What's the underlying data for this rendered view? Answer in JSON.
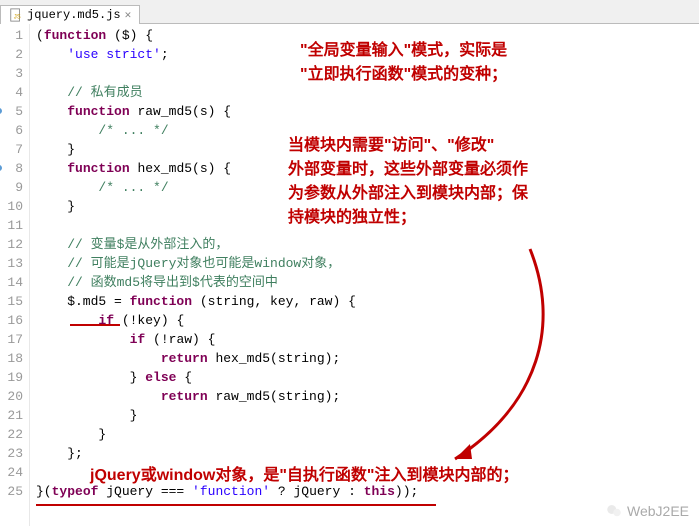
{
  "tab": {
    "filename": "jquery.md5.js"
  },
  "lines": [
    {
      "n": 1,
      "mark": false,
      "html": "(<kw>function</kw> ($) {"
    },
    {
      "n": 2,
      "mark": false,
      "html": "    <str>'use strict'</str>;"
    },
    {
      "n": 3,
      "mark": false,
      "html": ""
    },
    {
      "n": 4,
      "mark": false,
      "html": "    <cmt>// 私有成员</cmt>"
    },
    {
      "n": 5,
      "mark": true,
      "html": "    <kw>function</kw> raw_md5(s) {"
    },
    {
      "n": 6,
      "mark": false,
      "html": "        <cmt>/* ... */</cmt>"
    },
    {
      "n": 7,
      "mark": false,
      "html": "    }"
    },
    {
      "n": 8,
      "mark": true,
      "html": "    <kw>function</kw> hex_md5(s) {"
    },
    {
      "n": 9,
      "mark": false,
      "html": "        <cmt>/* ... */</cmt>"
    },
    {
      "n": 10,
      "mark": false,
      "html": "    }"
    },
    {
      "n": 11,
      "mark": false,
      "html": ""
    },
    {
      "n": 12,
      "mark": false,
      "html": "    <cmt>// 变量$是从外部注入的，</cmt>"
    },
    {
      "n": 13,
      "mark": false,
      "html": "    <cmt>// 可能是jQuery对象也可能是window对象，</cmt>"
    },
    {
      "n": 14,
      "mark": false,
      "html": "    <cmt>// 函数md5将导出到$代表的空间中</cmt>"
    },
    {
      "n": 15,
      "mark": false,
      "html": "    $.md5 = <kw>function</kw> (string, key, raw) {"
    },
    {
      "n": 16,
      "mark": false,
      "html": "        <kw>if</kw> (!key) {"
    },
    {
      "n": 17,
      "mark": false,
      "html": "            <kw>if</kw> (!raw) {"
    },
    {
      "n": 18,
      "mark": false,
      "html": "                <kw>return</kw> hex_md5(string);"
    },
    {
      "n": 19,
      "mark": false,
      "html": "            } <kw>else</kw> {"
    },
    {
      "n": 20,
      "mark": false,
      "html": "                <kw>return</kw> raw_md5(string);"
    },
    {
      "n": 21,
      "mark": false,
      "html": "            }"
    },
    {
      "n": 22,
      "mark": false,
      "html": "        }"
    },
    {
      "n": 23,
      "mark": false,
      "html": "    };"
    },
    {
      "n": 24,
      "mark": false,
      "html": ""
    },
    {
      "n": 25,
      "mark": false,
      "html": "}(<kw>typeof</kw> jQuery === <str>'function'</str> ? jQuery : <kw>this</kw>));"
    }
  ],
  "annotations": {
    "block1_line1": "\"全局变量输入\"模式，实际是",
    "block1_line2": "\"立即执行函数\"模式的变种；",
    "block2_line1": "当模块内需要\"访问\"、\"修改\"",
    "block2_line2": "外部变量时，这些外部变量必须作",
    "block2_line3": "为参数从外部注入到模块内部；保",
    "block2_line4": "持模块的独立性；",
    "bottom_line": "jQuery或window对象，是\"自执行函数\"注入到模块内部的；"
  },
  "watermark": "WebJ2EE"
}
